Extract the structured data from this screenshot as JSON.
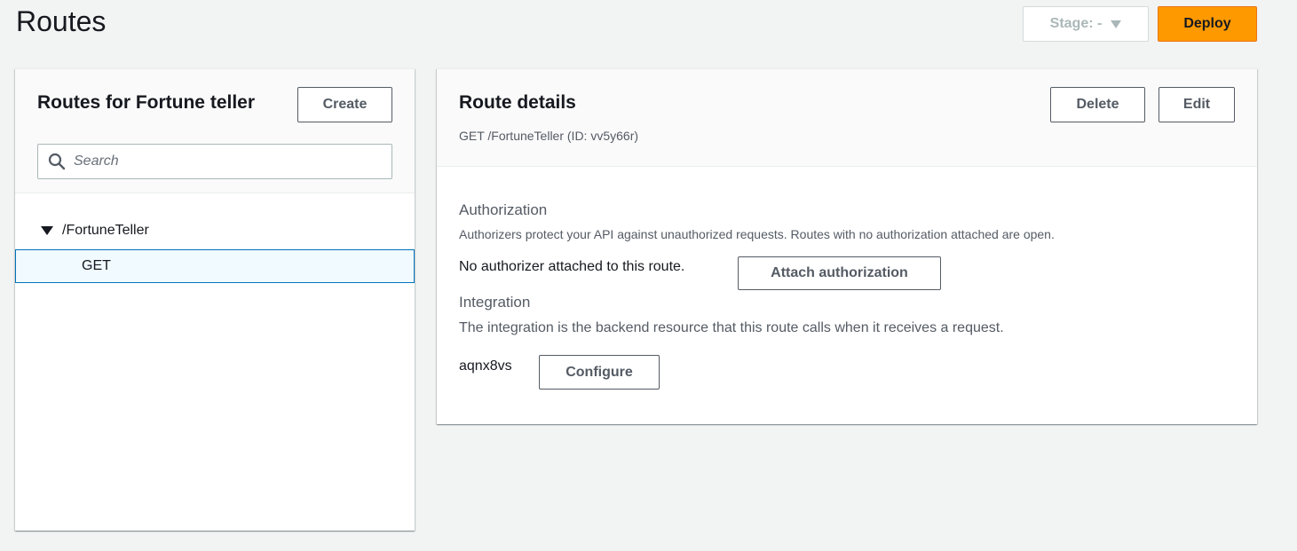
{
  "header": {
    "title": "Routes",
    "stage_label": "Stage: -",
    "deploy_label": "Deploy"
  },
  "routes_panel": {
    "title": "Routes for Fortune teller",
    "create_label": "Create",
    "search_placeholder": "Search",
    "search_value": "",
    "tree": {
      "path": "/FortuneTeller",
      "methods": [
        {
          "label": "GET",
          "selected": true
        }
      ]
    }
  },
  "details_panel": {
    "title": "Route details",
    "subtitle": "GET /FortuneTeller (ID: vv5y66r)",
    "delete_label": "Delete",
    "edit_label": "Edit",
    "authorization": {
      "heading": "Authorization",
      "description": "Authorizers protect your API against unauthorized requests. Routes with no authorization attached are open.",
      "status": "No authorizer attached to this route.",
      "attach_label": "Attach authorization"
    },
    "integration": {
      "heading": "Integration",
      "description": "The integration is the backend resource that this route calls when it receives a request.",
      "id": "aqnx8vs",
      "configure_label": "Configure"
    }
  },
  "colors": {
    "accent": "#ff9900",
    "selection_border": "#0073bb",
    "selection_bg": "#f1faff"
  }
}
